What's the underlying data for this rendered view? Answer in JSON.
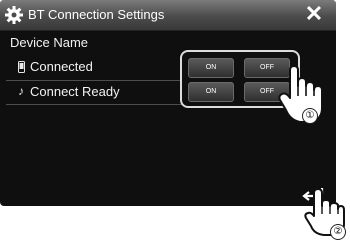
{
  "header": {
    "title": "BT Connection Settings",
    "gear_icon": "gear-icon",
    "close_label": "✕"
  },
  "section": {
    "title": "Device Name"
  },
  "rows": [
    {
      "icon": "phone-icon",
      "label": "Connected",
      "on_label": "ON",
      "off_label": "OFF"
    },
    {
      "icon": "music-note-icon",
      "label": "Connect Ready",
      "on_label": "ON",
      "off_label": "OFF"
    }
  ],
  "callouts": [
    "①",
    "②"
  ]
}
